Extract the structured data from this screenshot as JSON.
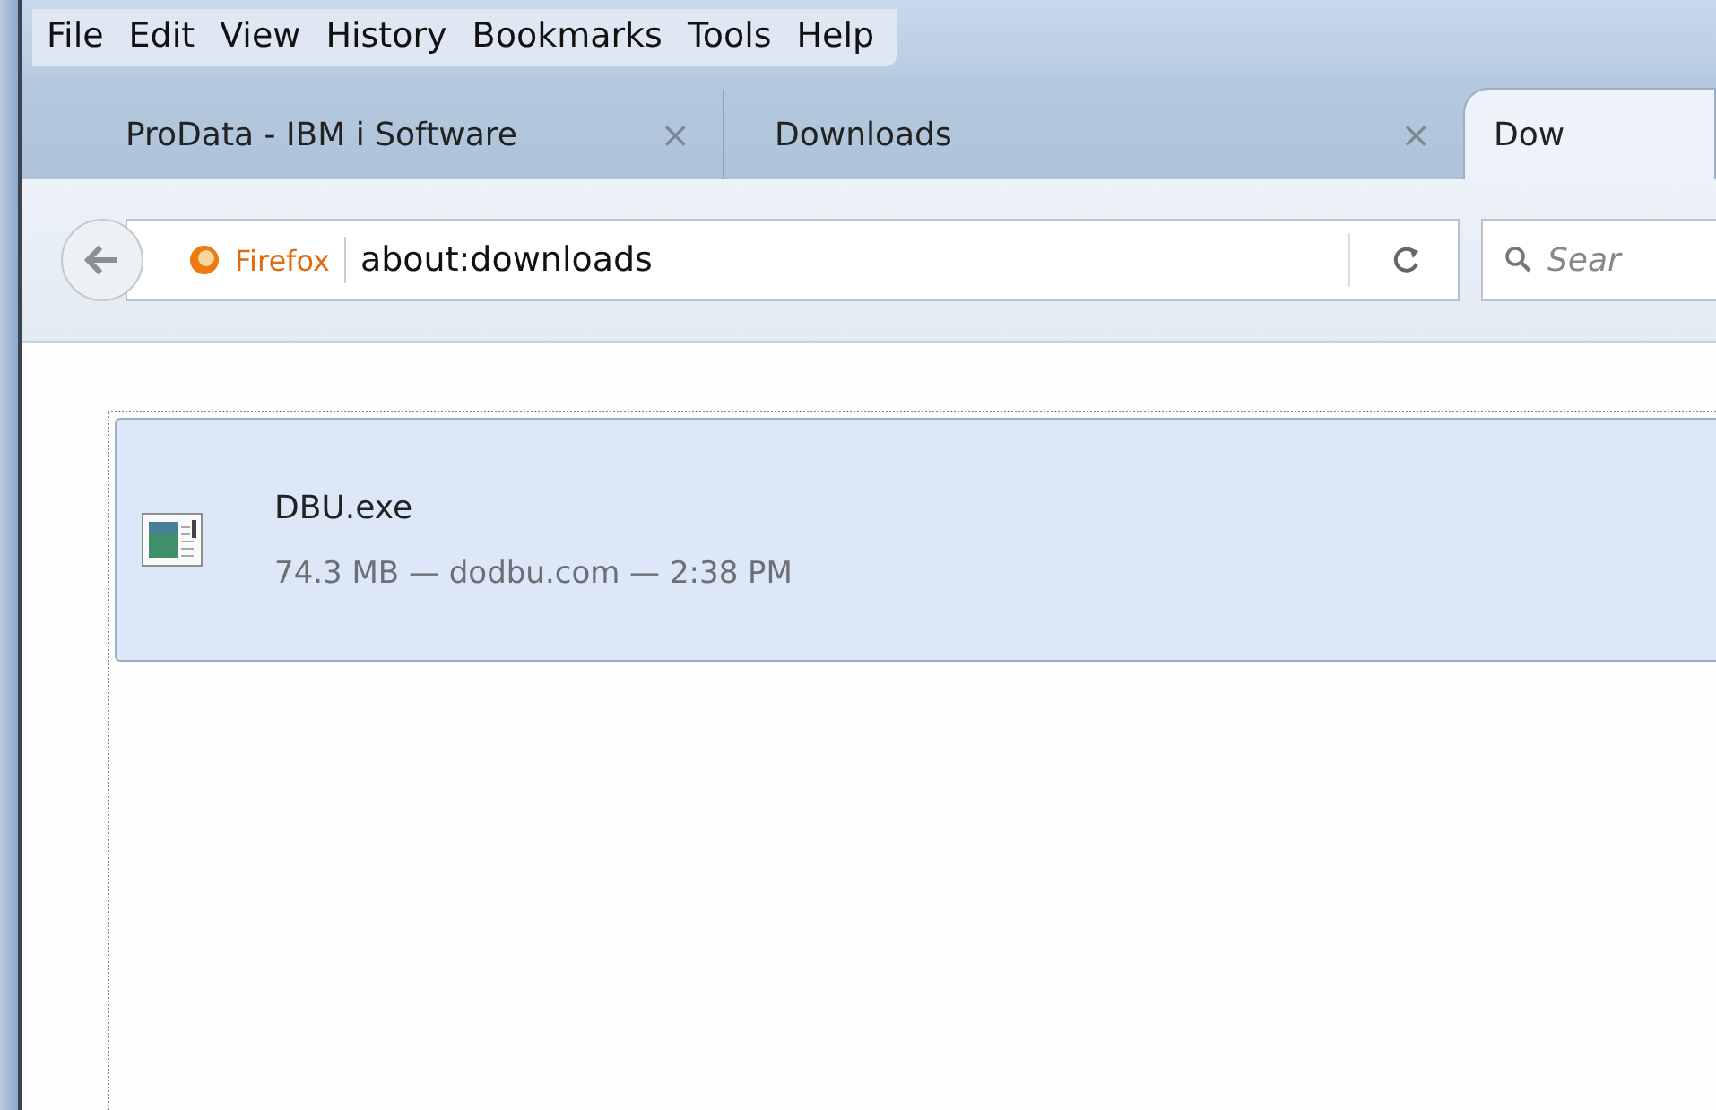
{
  "menu_bar": [
    "File",
    "Edit",
    "View",
    "History",
    "Bookmarks",
    "Tools",
    "Help"
  ],
  "tabs": [
    {
      "label": "ProData - IBM i Software",
      "selected": false,
      "close": "×"
    },
    {
      "label": "Downloads",
      "selected": false,
      "close": "×"
    },
    {
      "label": "Dow",
      "selected": true
    }
  ],
  "nav_bar": {
    "identity": "Firefox",
    "url": "about:downloads",
    "search": {
      "placeholder": "Sear"
    }
  },
  "downloads": [
    {
      "name": "DBU.exe",
      "details": "74.3 MB — dodbu.com — 2:38 PM",
      "selected": true
    }
  ]
}
